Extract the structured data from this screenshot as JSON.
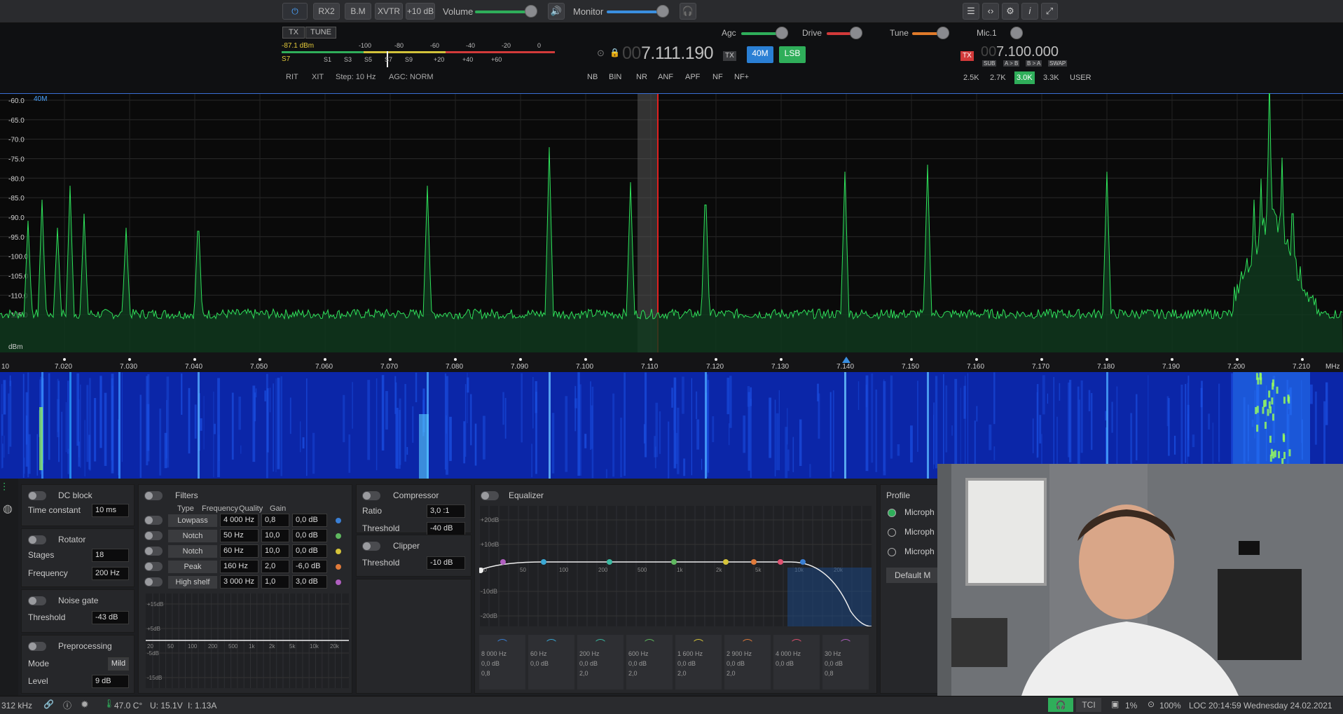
{
  "topbar": {
    "power_icon": "power-icon",
    "rx2": "RX2",
    "bm": "B.M",
    "xvtr": "XVTR",
    "plus10": "+10 dB",
    "volume_label": "Volume",
    "monitor_label": "Monitor"
  },
  "tx_row": {
    "tx": "TX",
    "tune": "TUNE",
    "agc": "Agc",
    "drive": "Drive",
    "tune_lbl": "Tune",
    "mic": "Mic.1"
  },
  "smeter": {
    "dbm": "-87.1 dBm",
    "s": "S7",
    "top_scale": [
      "-100",
      "-80",
      "-60",
      "-40",
      "-20",
      "0"
    ],
    "bottom_scale": [
      "S1",
      "S3",
      "S5",
      "S7",
      "S9",
      "+20",
      "+40",
      "+60"
    ]
  },
  "vfo_a": {
    "prefix": "00",
    "freq": "7.111.190",
    "tx": "TX",
    "band": "40M",
    "mode": "LSB"
  },
  "vfo_b": {
    "tx": "TX",
    "prefix": "00",
    "freq": "7.100.000",
    "sub": "SUB",
    "ab": "A > B",
    "ba": "B > A",
    "swap": "SWAP"
  },
  "row3": {
    "rit": "RIT",
    "xit": "XIT",
    "step": "Step: 10 Hz",
    "agc": "AGC: NORM",
    "dsp": [
      "NB",
      "BIN",
      "NR",
      "ANF",
      "APF",
      "NF",
      "NF+"
    ],
    "filters": [
      "2.5K",
      "2.7K",
      "3.0K",
      "3.3K",
      "USER"
    ],
    "active_filter": "3.0K"
  },
  "spectrum": {
    "band_label": "40M",
    "db_labels": [
      "-60.0",
      "-65.0",
      "-70.0",
      "-75.0",
      "-80.0",
      "-85.0",
      "-90.0",
      "-95.0",
      "-100.0",
      "-105.0",
      "-110.0",
      "-115.0"
    ],
    "unit": "dBm",
    "freq_labels": [
      "7.020",
      "7.030",
      "7.040",
      "7.050",
      "7.060",
      "7.070",
      "7.080",
      "7.090",
      "7.100",
      "7.110",
      "7.120",
      "7.130",
      "7.140",
      "7.150",
      "7.160",
      "7.170",
      "7.180",
      "7.190",
      "7.200",
      "7.210"
    ],
    "freq_unit": "MHz",
    "left_edge": "10"
  },
  "dcblock": {
    "title": "DC block",
    "tc_label": "Time constant",
    "tc": "10 ms"
  },
  "rotator": {
    "title": "Rotator",
    "stages_label": "Stages",
    "stages": "18",
    "freq_label": "Frequency",
    "freq": "200 Hz"
  },
  "noisegate": {
    "title": "Noise gate",
    "th_label": "Threshold",
    "th": "-43 dB"
  },
  "preproc": {
    "title": "Preprocessing",
    "mode_label": "Mode",
    "mode": "Mild",
    "level_label": "Level",
    "level": "9 dB"
  },
  "filters": {
    "title": "Filters",
    "headers": [
      "Type",
      "Frequency",
      "Quality",
      "Gain"
    ],
    "rows": [
      {
        "type": "Lowpass",
        "freq": "4 000 Hz",
        "q": "0,8",
        "gain": "0,0 dB",
        "color": "#3a7fd4"
      },
      {
        "type": "Notch",
        "freq": "50 Hz",
        "q": "10,0",
        "gain": "0,0 dB",
        "color": "#5fb85f"
      },
      {
        "type": "Notch",
        "freq": "60 Hz",
        "q": "10,0",
        "gain": "0,0 dB",
        "color": "#d6c43a"
      },
      {
        "type": "Peak",
        "freq": "160 Hz",
        "q": "2,0",
        "gain": "-6,0 dB",
        "color": "#e07a3a"
      },
      {
        "type": "High shelf",
        "freq": "3 000 Hz",
        "q": "1,0",
        "gain": "3,0 dB",
        "color": "#b05fc0"
      }
    ],
    "plot_y": [
      "+15dB",
      "+5dB",
      "-5dB",
      "-15dB"
    ],
    "plot_x": [
      "20",
      "50",
      "100",
      "200",
      "500",
      "1k",
      "2k",
      "5k",
      "10k",
      "20k"
    ]
  },
  "compressor": {
    "title": "Compressor",
    "ratio_label": "Ratio",
    "ratio": "3,0 :1",
    "th_label": "Threshold",
    "th": "-40 dB"
  },
  "clipper": {
    "title": "Clipper",
    "th_label": "Threshold",
    "th": "-10 dB"
  },
  "equalizer": {
    "title": "Equalizer",
    "y_labels": [
      "+20dB",
      "+10dB",
      "-10dB",
      "-20dB"
    ],
    "x_labels": [
      "20",
      "50",
      "100",
      "200",
      "500",
      "1k",
      "2k",
      "5k",
      "10k",
      "20k"
    ],
    "bands": [
      {
        "f": "8 000 Hz",
        "g": "0,0 dB",
        "q": "0,8",
        "color": "#3a7fd4"
      },
      {
        "f": "60 Hz",
        "g": "0,0 dB",
        "q": "",
        "color": "#3aa8d4"
      },
      {
        "f": "200 Hz",
        "g": "0,0 dB",
        "q": "2,0",
        "color": "#3ab8a0"
      },
      {
        "f": "600 Hz",
        "g": "0,0 dB",
        "q": "2,0",
        "color": "#5fb85f"
      },
      {
        "f": "1 600 Hz",
        "g": "0,0 dB",
        "q": "2,0",
        "color": "#d6c43a"
      },
      {
        "f": "2 900 Hz",
        "g": "0,0 dB",
        "q": "2,0",
        "color": "#e07a3a"
      },
      {
        "f": "4 000 Hz",
        "g": "0,0 dB",
        "q": "",
        "color": "#e05070"
      },
      {
        "f": "30 Hz",
        "g": "0,0 dB",
        "q": "0,8",
        "color": "#b05fc0"
      }
    ]
  },
  "profile": {
    "title": "Profile",
    "items": [
      "Microph",
      "Microph",
      "Microph"
    ],
    "default": "Default M"
  },
  "status": {
    "bw": "312 kHz",
    "temp": "47.0 C°",
    "voltage": "U: 15.1V",
    "current": "I: 1.13A",
    "tci": "TCI",
    "cpu": "1%",
    "zoom": "100%",
    "loc": "LOC 20:14:59 Wednesday 24.02.2021"
  }
}
